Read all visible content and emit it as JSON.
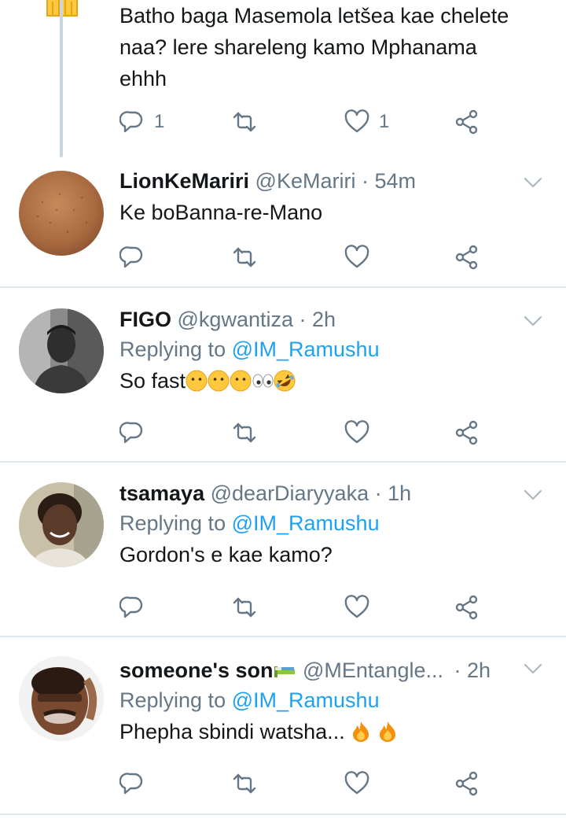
{
  "colors": {
    "accent": "#1da1f2",
    "muted": "#657786",
    "text": "#14171a",
    "divider": "#e1e8ed"
  },
  "parent": {
    "text_lines": [
      "Batho baga Masemola letšea kae chelete",
      "naa? lere shareleng kamo Mphanama",
      "ehhh"
    ],
    "reply_count": "1",
    "like_count": "1"
  },
  "tweets": [
    {
      "name": "LionKeMariri",
      "handle": "@KeMariri",
      "sep": "·",
      "time": "54m",
      "replying_to_label": "",
      "mention": "",
      "text": "Ke boBanna-re-Mano"
    },
    {
      "name": "FIGO",
      "handle": "@kgwantiza",
      "sep": "·",
      "time": "2h",
      "replying_to_label": "Replying to",
      "mention": "@IM_Ramushu",
      "text": "So fast"
    },
    {
      "name": "tsamaya",
      "handle": "@dearDiaryyaka",
      "sep": "·",
      "time": "1h",
      "replying_to_label": "Replying to",
      "mention": "@IM_Ramushu",
      "text": "Gordon's e kae kamo?"
    },
    {
      "name": "someone's son",
      "handle": "@MEntangle...",
      "sep": "·",
      "time": "2h",
      "replying_to_label": "Replying to",
      "mention": "@IM_Ramushu",
      "text": "Phepha sbindi watsha..."
    }
  ],
  "icons": {
    "reply": "reply-icon",
    "retweet": "retweet-icon",
    "like": "heart-icon",
    "share": "share-icon",
    "chevron": "chevron-down-icon",
    "emoji_neutral": "neutral-face-emoji",
    "emoji_eyes": "eyes-emoji",
    "emoji_laugh": "rolling-laughing-emoji",
    "emoji_bed": "bed-emoji",
    "emoji_fire": "fire-emoji"
  }
}
